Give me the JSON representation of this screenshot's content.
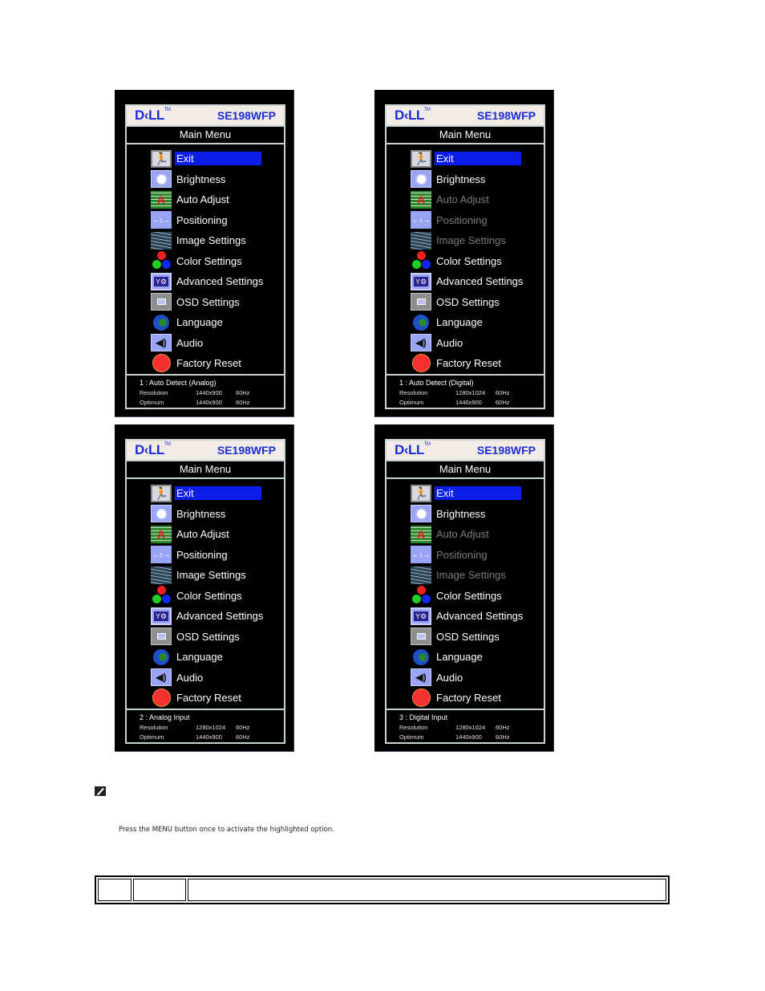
{
  "osd_panels": [
    {
      "brand": "D<LL",
      "model": "SE198WFP",
      "menu_title": "Main Menu",
      "items": [
        {
          "label": "Exit",
          "icon": "exit-icon",
          "enabled": true,
          "highlighted": true
        },
        {
          "label": "Brightness",
          "icon": "brightness-icon",
          "enabled": true
        },
        {
          "label": "Auto Adjust",
          "icon": "auto-adjust-icon",
          "enabled": true
        },
        {
          "label": "Positioning",
          "icon": "positioning-icon",
          "enabled": true
        },
        {
          "label": "Image Settings",
          "icon": "image-settings-icon",
          "enabled": true
        },
        {
          "label": "Color Settings",
          "icon": "color-settings-icon",
          "enabled": true
        },
        {
          "label": "Advanced Settings",
          "icon": "advanced-settings-icon",
          "enabled": true
        },
        {
          "label": "OSD Settings",
          "icon": "osd-settings-icon",
          "enabled": true
        },
        {
          "label": "Language",
          "icon": "globe-icon",
          "enabled": true
        },
        {
          "label": "Audio",
          "icon": "speaker-icon",
          "enabled": true
        },
        {
          "label": "Factory Reset",
          "icon": "factory-reset-icon",
          "enabled": true
        }
      ],
      "info": {
        "title": "1 : Auto Detect (Analog)",
        "resolution_label": "Resolution",
        "resolution": "1440x900",
        "resolution_hz": "60Hz",
        "optimum_label": "Optimum",
        "optimum": "1440x900",
        "optimum_hz": "60Hz"
      }
    },
    {
      "brand": "D<LL",
      "model": "SE198WFP",
      "menu_title": "Main Menu",
      "items": [
        {
          "label": "Exit",
          "icon": "exit-icon",
          "enabled": true,
          "highlighted": true
        },
        {
          "label": "Brightness",
          "icon": "brightness-icon",
          "enabled": true
        },
        {
          "label": "Auto Adjust",
          "icon": "auto-adjust-icon",
          "enabled": false
        },
        {
          "label": "Positioning",
          "icon": "positioning-icon",
          "enabled": false
        },
        {
          "label": "Image Settings",
          "icon": "image-settings-icon",
          "enabled": false
        },
        {
          "label": "Color Settings",
          "icon": "color-settings-icon",
          "enabled": true
        },
        {
          "label": "Advanced Settings",
          "icon": "advanced-settings-icon",
          "enabled": true
        },
        {
          "label": "OSD Settings",
          "icon": "osd-settings-icon",
          "enabled": true
        },
        {
          "label": "Language",
          "icon": "globe-icon",
          "enabled": true
        },
        {
          "label": "Audio",
          "icon": "speaker-icon",
          "enabled": true
        },
        {
          "label": "Factory Reset",
          "icon": "factory-reset-icon",
          "enabled": true
        }
      ],
      "info": {
        "title": "1 : Auto Detect (Digital)",
        "resolution_label": "Resolution",
        "resolution": "1280x1024",
        "resolution_hz": "60Hz",
        "optimum_label": "Optimum",
        "optimum": "1440x900",
        "optimum_hz": "60Hz"
      }
    },
    {
      "brand": "D<LL",
      "model": "SE198WFP",
      "menu_title": "Main Menu",
      "items": [
        {
          "label": "Exit",
          "icon": "exit-icon",
          "enabled": true,
          "highlighted": true
        },
        {
          "label": "Brightness",
          "icon": "brightness-icon",
          "enabled": true
        },
        {
          "label": "Auto Adjust",
          "icon": "auto-adjust-icon",
          "enabled": true
        },
        {
          "label": "Positioning",
          "icon": "positioning-icon",
          "enabled": true
        },
        {
          "label": "Image Settings",
          "icon": "image-settings-icon",
          "enabled": true
        },
        {
          "label": "Color Settings",
          "icon": "color-settings-icon",
          "enabled": true
        },
        {
          "label": "Advanced Settings",
          "icon": "advanced-settings-icon",
          "enabled": true
        },
        {
          "label": "OSD Settings",
          "icon": "osd-settings-icon",
          "enabled": true
        },
        {
          "label": "Language",
          "icon": "globe-icon",
          "enabled": true
        },
        {
          "label": "Audio",
          "icon": "speaker-icon",
          "enabled": true
        },
        {
          "label": "Factory Reset",
          "icon": "factory-reset-icon",
          "enabled": true
        }
      ],
      "info": {
        "title": "2 : Analog Input",
        "resolution_label": "Resolution",
        "resolution": "1280x1024",
        "resolution_hz": "60Hz",
        "optimum_label": "Optimum",
        "optimum": "1440x900",
        "optimum_hz": "60Hz"
      }
    },
    {
      "brand": "D<LL",
      "model": "SE198WFP",
      "menu_title": "Main Menu",
      "items": [
        {
          "label": "Exit",
          "icon": "exit-icon",
          "enabled": true,
          "highlighted": true
        },
        {
          "label": "Brightness",
          "icon": "brightness-icon",
          "enabled": true
        },
        {
          "label": "Auto Adjust",
          "icon": "auto-adjust-icon",
          "enabled": false
        },
        {
          "label": "Positioning",
          "icon": "positioning-icon",
          "enabled": false
        },
        {
          "label": "Image Settings",
          "icon": "image-settings-icon",
          "enabled": false
        },
        {
          "label": "Color Settings",
          "icon": "color-settings-icon",
          "enabled": true
        },
        {
          "label": "Advanced Settings",
          "icon": "advanced-settings-icon",
          "enabled": true
        },
        {
          "label": "OSD Settings",
          "icon": "osd-settings-icon",
          "enabled": true
        },
        {
          "label": "Language",
          "icon": "globe-icon",
          "enabled": true
        },
        {
          "label": "Audio",
          "icon": "speaker-icon",
          "enabled": true
        },
        {
          "label": "Factory Reset",
          "icon": "factory-reset-icon",
          "enabled": true
        }
      ],
      "info": {
        "title": "3 : Digital Input",
        "resolution_label": "Resolution",
        "resolution": "1280x1024",
        "resolution_hz": "60Hz",
        "optimum_label": "Optimum",
        "optimum": "1440x900",
        "optimum_hz": "60Hz"
      }
    }
  ],
  "note_icon": "pencil-note-icon",
  "instruction": "Press the MENU button once to activate the highlighted option.",
  "table": {
    "columns": [
      "",
      "",
      ""
    ]
  }
}
